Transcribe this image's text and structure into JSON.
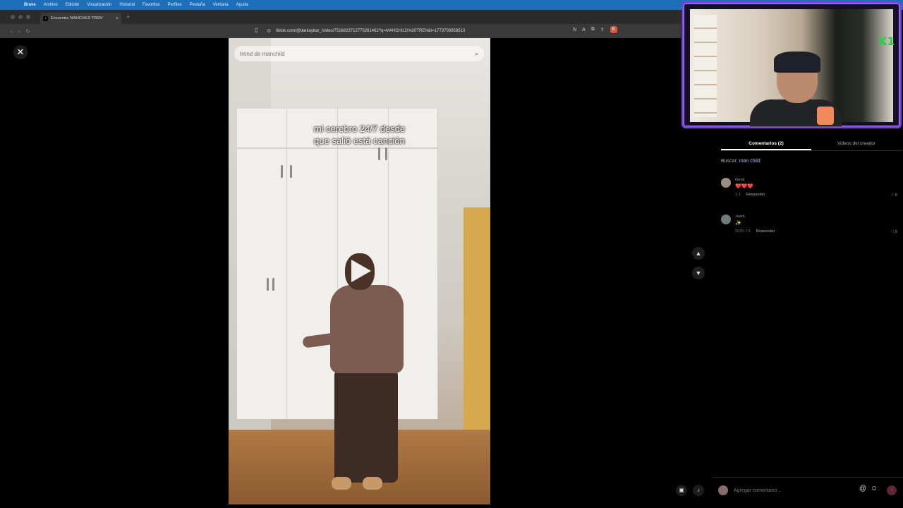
{
  "menubar": {
    "items": [
      "Brave",
      "Archivo",
      "Edición",
      "Visualización",
      "Historial",
      "Favoritos",
      "Perfiles",
      "Pestaña",
      "Ventana",
      "Ayuda"
    ]
  },
  "browser": {
    "tab_title": "Encuentra 'MAHCHILD TREN'",
    "url": "tiktok.com/@danlaybar_/video/7516823712775261462?q=MAHCHILD%20TREN&t=1773709958513"
  },
  "video": {
    "search_placeholder": "trend de manchild",
    "caption_line1": "mi cerebro 24/7 desde",
    "caption_line2": "que salió está canción"
  },
  "comments_panel": {
    "tabs": [
      "Comentarios (2)",
      "Videos del creador"
    ],
    "search_label": "Buscar:",
    "search_keyword": "man child",
    "comments": [
      {
        "user": "Geral",
        "text": "❤️❤️❤️",
        "date": "1-1",
        "reply": "Responder",
        "likes": "0"
      },
      {
        "user": "JeanL",
        "text": "✨",
        "date": "2025-7-5",
        "reply": "Responder",
        "likes": "0"
      }
    ],
    "input_placeholder": "Agregar comentario..."
  },
  "webcam": {
    "badge": "K1"
  },
  "icons": {
    "close": "close-icon",
    "play": "play-icon",
    "search": "search-icon",
    "up": "chevron-up-icon",
    "down": "chevron-down-icon"
  }
}
